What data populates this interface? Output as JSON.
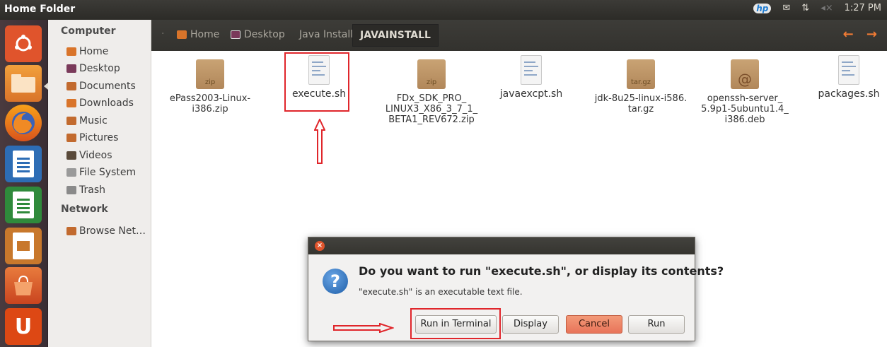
{
  "window": {
    "title": "Home Folder"
  },
  "tray": {
    "brand": "hp",
    "network": "⇅",
    "volume": "◂×",
    "time": "1:27 PM"
  },
  "sidebar": {
    "computer_header": "Computer",
    "places": [
      {
        "label": "Home",
        "color": "#d9742a"
      },
      {
        "label": "Desktop",
        "color": "#7a3a5a"
      },
      {
        "label": "Documents",
        "color": "#c26a2e"
      },
      {
        "label": "Downloads",
        "color": "#d9742a"
      },
      {
        "label": "Music",
        "color": "#c26a2e"
      },
      {
        "label": "Pictures",
        "color": "#c26a2e"
      },
      {
        "label": "Videos",
        "color": "#5a4a3a"
      },
      {
        "label": "File System",
        "color": "#9a9a9a"
      },
      {
        "label": "Trash",
        "color": "#8a8a8a"
      }
    ],
    "network_header": "Network",
    "network_items": [
      {
        "label": "Browse Net…",
        "color": "#c26a2e"
      }
    ]
  },
  "pathbar": {
    "crumbs": [
      "Home",
      "Desktop",
      "Java Install",
      "JAVAINSTALL"
    ],
    "nav": "← →"
  },
  "files": [
    {
      "name": "ePass2003-Linux-i386.zip",
      "lines": [
        "ePass2003-Linux-",
        "i386.zip"
      ],
      "kind": "zip",
      "badge": "zip"
    },
    {
      "name": "execute.sh",
      "lines": [
        "execute.sh"
      ],
      "kind": "text",
      "badge": ""
    },
    {
      "name": "FDx_SDK_PRO_LINUX3_X86_3_7_1_BETA1_REV672.zip",
      "lines": [
        "FDx_SDK_PRO_",
        "LINUX3_X86_3_7_1_",
        "BETA1_REV672.zip"
      ],
      "kind": "zip",
      "badge": "zip"
    },
    {
      "name": "javaexcpt.sh",
      "lines": [
        "javaexcpt.sh"
      ],
      "kind": "text",
      "badge": ""
    },
    {
      "name": "jdk-8u25-linux-i586.tar.gz",
      "lines": [
        "jdk-8u25-linux-i586.",
        "tar.gz"
      ],
      "kind": "zip",
      "badge": "tar.gz"
    },
    {
      "name": "openssh-server_5.9p1-5ubuntu1.4_i386.deb",
      "lines": [
        "openssh-server_",
        "5.9p1-5ubuntu1.4_",
        "i386.deb"
      ],
      "kind": "deb",
      "badge": "@"
    },
    {
      "name": "packages.sh",
      "lines": [
        "packages.sh"
      ],
      "kind": "text",
      "badge": ""
    }
  ],
  "dialog": {
    "close": "×",
    "icon": "?",
    "question": "Do you want to run \"execute.sh\", or display its contents?",
    "subtext": "\"execute.sh\" is an executable text file.",
    "buttons": {
      "run_in_terminal": "Run in Terminal",
      "display": "Display",
      "cancel": "Cancel",
      "run": "Run"
    }
  },
  "colors": {
    "accent": "#e0542c",
    "highlight_box": "#e0262b",
    "panel": "#3c3b37"
  }
}
